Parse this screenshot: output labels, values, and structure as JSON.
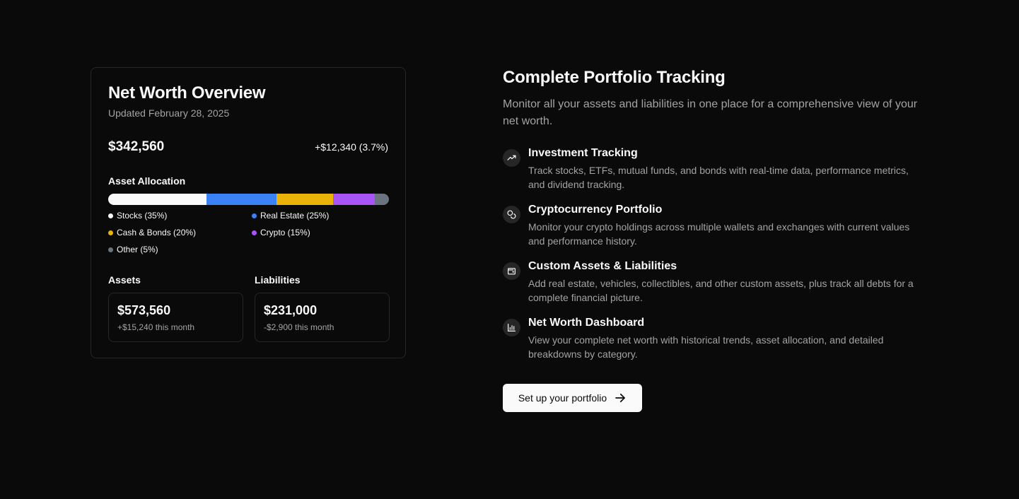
{
  "card": {
    "title": "Net Worth Overview",
    "updated": "Updated February 28, 2025",
    "net_worth": "$342,560",
    "change": "+$12,340 (3.7%)",
    "allocation_label": "Asset Allocation",
    "allocation": [
      {
        "label": "Stocks (35%)",
        "percent": 35,
        "color": "#fafafa"
      },
      {
        "label": "Real Estate (25%)",
        "percent": 25,
        "color": "#3b82f6"
      },
      {
        "label": "Cash & Bonds (20%)",
        "percent": 20,
        "color": "#eab308"
      },
      {
        "label": "Crypto (15%)",
        "percent": 15,
        "color": "#a855f7"
      },
      {
        "label": "Other (5%)",
        "percent": 5,
        "color": "#6b7280"
      }
    ],
    "assets": {
      "label": "Assets",
      "value": "$573,560",
      "change": "+$15,240 this month"
    },
    "liabilities": {
      "label": "Liabilities",
      "value": "$231,000",
      "change": "-$2,900 this month"
    }
  },
  "right": {
    "title": "Complete Portfolio Tracking",
    "description": "Monitor all your assets and liabilities in one place for a comprehensive view of your net worth.",
    "features": [
      {
        "icon": "trending-up-icon",
        "title": "Investment Tracking",
        "description": "Track stocks, ETFs, mutual funds, and bonds with real-time data, performance metrics, and dividend tracking."
      },
      {
        "icon": "coins-icon",
        "title": "Cryptocurrency Portfolio",
        "description": "Monitor your crypto holdings across multiple wallets and exchanges with current values and performance history."
      },
      {
        "icon": "wallet-icon",
        "title": "Custom Assets & Liabilities",
        "description": "Add real estate, vehicles, collectibles, and other custom assets, plus track all debts for a complete financial picture."
      },
      {
        "icon": "bar-chart-icon",
        "title": "Net Worth Dashboard",
        "description": "View your complete net worth with historical trends, asset allocation, and detailed breakdowns by category."
      }
    ],
    "cta_label": "Set up your portfolio",
    "cta_icon": "arrow-right-icon"
  }
}
